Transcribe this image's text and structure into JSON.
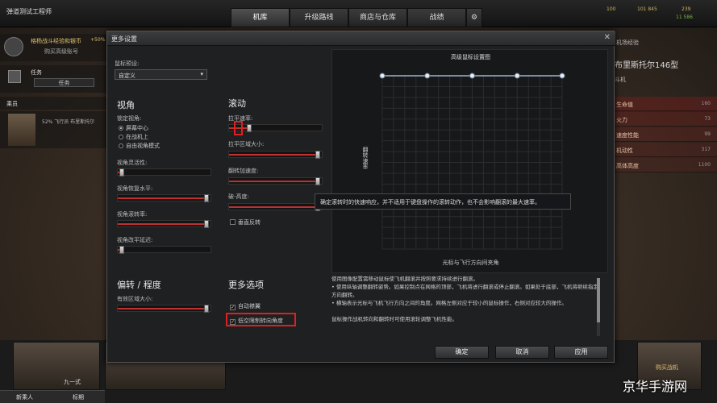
{
  "topbar": {
    "server_label": "弹道测试工程师",
    "tabs": [
      {
        "label": "机库",
        "active": true
      },
      {
        "label": "升级路线",
        "active": false
      },
      {
        "label": "商店与仓库",
        "active": false
      },
      {
        "label": "战绩",
        "active": false
      }
    ],
    "resource1": "100",
    "resource2": "101 845",
    "resource3": "239",
    "resource4": "11 586"
  },
  "left_panel": {
    "mission_title": "格杨战斗经验和银币",
    "mission_bonus": "+50%",
    "mission_sub": "购买高级账号",
    "task_label": "任务",
    "task_btn": "任务",
    "crew_label": "乘员",
    "crew_info": "52% 飞行员 布里斯托尔"
  },
  "right_panel": {
    "header": "机场经验",
    "plane_name": "布里斯托尔146型",
    "plane_sub": "斗机",
    "stats": [
      {
        "label": "生命值",
        "value": "160"
      },
      {
        "label": "火力",
        "value": "73"
      },
      {
        "label": "速度性能",
        "value": "99"
      },
      {
        "label": "机动性",
        "value": "317"
      },
      {
        "label": "高体高度",
        "value": "1100"
      }
    ]
  },
  "bottom": {
    "card1_label": "九一式",
    "footer1": "新乘人",
    "footer2": "标期",
    "right_card": "购买战机"
  },
  "dialog": {
    "title": "更多设置",
    "preset_label": "鼠标预设:",
    "preset_value": "自定义",
    "view": {
      "heading": "视角",
      "lock_label": "锁定视角:",
      "options": [
        "屏幕中心",
        "在战机上",
        "自由视角模式"
      ],
      "selected": 0,
      "sliders": [
        {
          "label": "视角灵活性:",
          "value": 0.02
        },
        {
          "label": "视角恢复水平:",
          "value": 0.98
        },
        {
          "label": "视角滚转率:",
          "value": 0.98
        },
        {
          "label": "视角改平延迟:",
          "value": 0.02
        }
      ]
    },
    "deflection": {
      "heading": "偏转 / 程度",
      "sliders": [
        {
          "label": "有效区域大小:",
          "value": 0.98
        }
      ]
    },
    "roll": {
      "heading": "滚动",
      "sliders": [
        {
          "label": "拉平速率:",
          "value": 0.2
        },
        {
          "label": "拉平区域大小:",
          "value": 0.98
        },
        {
          "label": "翻转加速度:",
          "value": 0.98
        },
        {
          "label": "破-高度:",
          "value": 0.98
        }
      ],
      "invert_label": "垂直反转",
      "invert_checked": false
    },
    "more": {
      "heading": "更多选项",
      "auto_label": "自动襟翼",
      "auto_checked": true,
      "limit_label": "低空限制转向角度",
      "limit_checked": true
    },
    "chart": {
      "title": "高级鼠标设置图",
      "ylabel": "翻转速率",
      "xlabel": "光标与飞行方向间夹角"
    },
    "description": [
      "使用图像配置需移动鼠标使飞机翻滚并按照要求持续进行翻滚。",
      "• 使用纵轴调整翻转姿势。如果控制点在网格的顶部，飞机将进行翻滚或停止翻滚。如果处于底部，飞机将继续指定方向翻转。",
      "• 横轴表示光标与飞机飞行方向之间的角度。网格左侧对应于较小的鼠标操作，右侧对应较大的操作。",
      "",
      "鼠标操作战机转向和翻转时可使用滚轮调整飞机性能。"
    ],
    "buttons": {
      "ok": "确定",
      "cancel": "取消",
      "apply": "应用"
    }
  },
  "tooltip": "确定滚转时的快速响应，并不适用于键盘操作的滚转动作，也不会影响翻滚的最大速率。",
  "watermark": "京华手游网",
  "chart_data": {
    "type": "line",
    "title": "高级鼠标设置图",
    "xlabel": "光标与飞行方向间夹角",
    "ylabel": "翻转速率",
    "series": [
      {
        "values": [
          1,
          1,
          1,
          1,
          1
        ]
      }
    ],
    "ylim": [
      0,
      1
    ],
    "grid": true
  }
}
